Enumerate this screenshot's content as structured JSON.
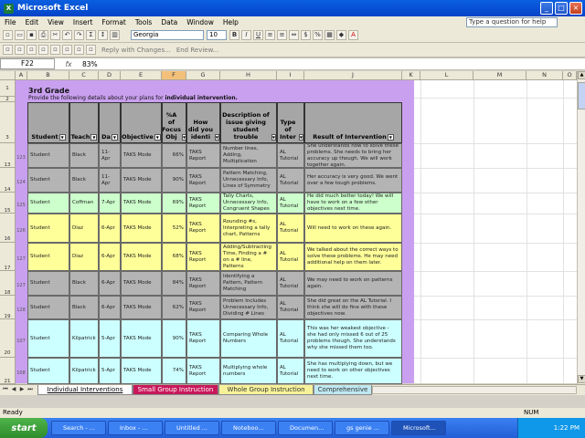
{
  "window": {
    "title": "Microsoft Excel",
    "min": "_",
    "max": "□",
    "close": "×"
  },
  "menu": [
    "File",
    "Edit",
    "View",
    "Insert",
    "Format",
    "Tools",
    "Data",
    "Window",
    "Help"
  ],
  "help_placeholder": "Type a question for help",
  "toolbar": {
    "font": "Georgia",
    "size": "10",
    "reply": "Reply with Changes...",
    "end_review": "End Review..."
  },
  "formula": {
    "cell": "F22",
    "fx": "fx",
    "value": "83%"
  },
  "columns": [
    "A",
    "B",
    "C",
    "D",
    "E",
    "F",
    "G",
    "H",
    "I",
    "J",
    "K",
    "L",
    "M",
    "N",
    "O"
  ],
  "rows_left": [
    "1",
    "2",
    "3",
    "13",
    "14",
    "15",
    "16",
    "17",
    "18",
    "19",
    "20",
    "21"
  ],
  "sheet": {
    "grade": "3rd Grade",
    "desc_prefix": "Provide the following details about your plans for ",
    "desc_bold": "individual intervention.",
    "headers": [
      "Student",
      "Teach",
      "Da",
      "Objective",
      "%A of Focus Obj",
      "How did you identi",
      "Description of issue giving student trouble",
      "Type of Inter",
      "Result of Intervention"
    ],
    "rows": [
      {
        "num": "123",
        "student": "Student",
        "teacher": "Black",
        "date": "11-Apr",
        "objective": "TAKS Mode",
        "pct": "66%",
        "how": "TAKS Report",
        "issue": "Number lines, Adding, Multiplication",
        "type": "AL Tutorial",
        "result": "She understands how to solve these problems. She needs to bring her accuracy up though. We will work together again."
      },
      {
        "num": "124",
        "student": "Student",
        "teacher": "Black",
        "date": "11-Apr",
        "objective": "TAKS Mode",
        "pct": "90%",
        "how": "TAKS Report",
        "issue": "Pattern Matching, Unnecessary Info, Lines of Symmetry",
        "type": "AL Tutorial",
        "result": "Her accuracy is very good. We went over a few tough problems."
      },
      {
        "num": "125",
        "student": "Student",
        "teacher": "Coffman",
        "date": "7-Apr",
        "objective": "TAKS Mode",
        "pct": "69%",
        "how": "TAKS Report",
        "issue": "Tally Charts, Unnecessary Info, Congruent Shapes",
        "type": "AL Tutorial",
        "result": "He did much better today! We will have to work on a few other objectives next time."
      },
      {
        "num": "126",
        "student": "Student",
        "teacher": "Diaz",
        "date": "6-Apr",
        "objective": "TAKS Mode",
        "pct": "52%",
        "how": "TAKS Report",
        "issue": "Rounding #s, Interpreting a tally chart, Patterns",
        "type": "AL Tutorial",
        "result": "Will need to work on these again."
      },
      {
        "num": "127",
        "student": "Student",
        "teacher": "Diaz",
        "date": "6-Apr",
        "objective": "TAKS Mode",
        "pct": "68%",
        "how": "TAKS Report",
        "issue": "Adding/Subtracting Time, Finding a # on a # line, Patterns",
        "type": "AL Tutorial",
        "result": "We talked about the correct ways to solve these problems. He may need additional help on them later."
      },
      {
        "num": "127",
        "student": "Student",
        "teacher": "Black",
        "date": "6-Apr",
        "objective": "TAKS Mode",
        "pct": "84%",
        "how": "TAKS Report",
        "issue": "Identifying a Pattern, Pattern Matching",
        "type": "AL Tutorial",
        "result": "We may need to work on patterns again."
      },
      {
        "num": "128",
        "student": "Student",
        "teacher": "Black",
        "date": "6-Apr",
        "objective": "TAKS Mode",
        "pct": "62%",
        "how": "TAKS Report",
        "issue": "Problem Includes Unnecessary Info, Dividing # Lines",
        "type": "AL Tutorial",
        "result": "She did great on the AL Tutorial. I think she will do fine with these objectives now."
      },
      {
        "num": "107",
        "student": "Student",
        "teacher": "Kilpatrick",
        "date": "5-Apr",
        "objective": "TAKS Mode",
        "pct": "90%",
        "how": "TAKS Report",
        "issue": "Comparing Whole Numbers",
        "type": "AL Tutorial",
        "result": "This was her weakest objective - she had only missed 6 out of 25 problems though. She understands why she missed them too."
      },
      {
        "num": "108",
        "student": "Student",
        "teacher": "Kilpatrick",
        "date": "5-Apr",
        "objective": "TAKS Mode",
        "pct": "74%",
        "how": "TAKS Report",
        "issue": "Multiplying whole numbers",
        "type": "AL Tutorial",
        "result": "She has multiplying down, but we need to work on other objectives next time."
      }
    ]
  },
  "colors": {
    "gray": "#b4b4b4",
    "green": "#ccffcc",
    "yellow": "#ffff99",
    "cyan": "#ccffff",
    "purple": "#c9a0ef"
  },
  "tabs": [
    "Individual Interventions",
    "Small Group Instruction",
    "Whole Group Instruction",
    "Comprehensive"
  ],
  "status": {
    "ready": "Ready",
    "num": "NUM"
  },
  "taskbar": {
    "start": "start",
    "items": [
      "Search - ...",
      "Inbox - ...",
      "Untitled ...",
      "Noteboo...",
      "Documen...",
      "gs genie ...",
      "Microsoft..."
    ],
    "clock": "1:22 PM"
  }
}
